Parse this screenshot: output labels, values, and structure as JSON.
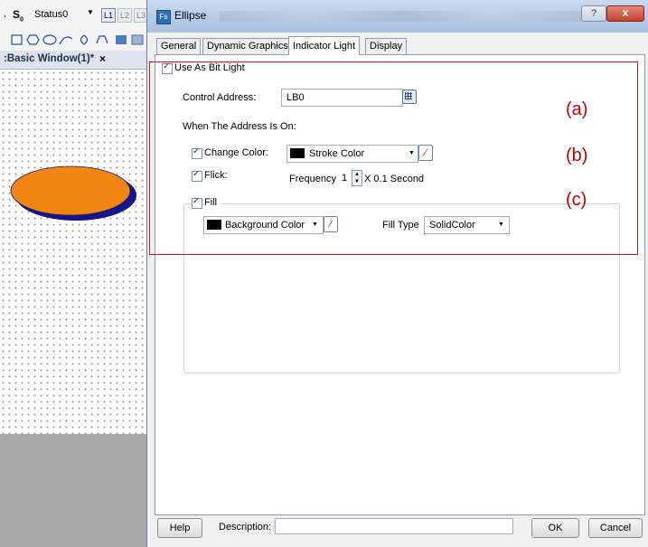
{
  "editor": {
    "status_prefix": "S",
    "status_sub": "0",
    "status_value": "Status0",
    "tab_label": ":Basic Window(1)*",
    "tab_close": "×",
    "shape_fill_color": "#f08512",
    "shape_shadow_color": "#14148c"
  },
  "dialog": {
    "title": "Ellipse",
    "title_icon": "Fs",
    "help_glyph": "?",
    "close_glyph": "x",
    "tabs": [
      "General",
      "Dynamic Graphics",
      "Indicator Light",
      "Display"
    ],
    "active_tab": "Indicator Light",
    "use_as_bit_light": {
      "label": "Use As Bit Light",
      "checked": true
    },
    "control_address": {
      "label": "Control Address:",
      "value": "LB0"
    },
    "when_on_label": "When The Address Is On:",
    "change_color": {
      "label": "Change Color:",
      "checked": true,
      "value": "Stroke Color",
      "swatch": "#000000"
    },
    "flick": {
      "label": "Flick:",
      "checked": true,
      "frequency_label": "Frequency:",
      "frequency_value": "1",
      "unit": "X 0.1 Second"
    },
    "fill": {
      "label": "Fill",
      "checked": true,
      "color_value": "Background Color",
      "swatch": "#000000",
      "fill_type_label": "Fill Type",
      "fill_type_value": "SolidColor"
    },
    "footer": {
      "help": "Help",
      "description_label": "Description:",
      "description_value": "",
      "ok": "OK",
      "cancel": "Cancel"
    }
  },
  "annotations": {
    "a": "(a)",
    "b": "(b)",
    "c": "(c)",
    "color": "#e01010"
  }
}
